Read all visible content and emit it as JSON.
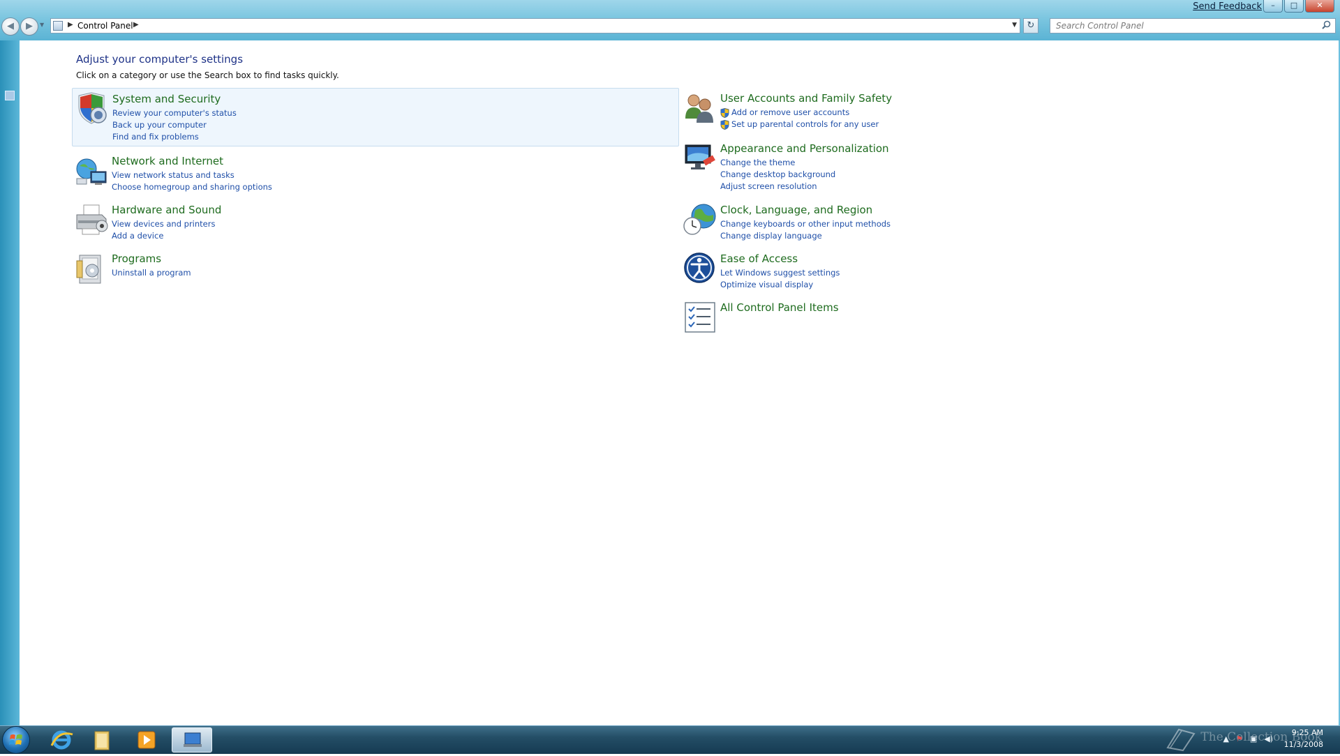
{
  "window": {
    "send_feedback": "Send Feedback",
    "minimize": "–",
    "maximize": "□",
    "close": "✕"
  },
  "nav": {
    "back_glyph": "◀",
    "forward_glyph": "▶"
  },
  "address": {
    "crumb": "Control Panel",
    "separator": "▶",
    "dropdown": "▼",
    "refresh_glyph": "↻"
  },
  "search": {
    "placeholder": "Search Control Panel",
    "icon": "search-icon"
  },
  "page": {
    "heading": "Adjust your computer's settings",
    "subheading": "Click on a category or use the Search box to find tasks quickly."
  },
  "categories_left": [
    {
      "title": "System and Security",
      "icon": "shield-icon",
      "links": [
        "Review your computer's status",
        "Back up your computer",
        "Find and fix problems"
      ]
    },
    {
      "title": "Network and Internet",
      "icon": "network-globe-icon",
      "links": [
        "View network status and tasks",
        "Choose homegroup and sharing options"
      ]
    },
    {
      "title": "Hardware and Sound",
      "icon": "printer-icon",
      "links": [
        "View devices and printers",
        "Add a device"
      ]
    },
    {
      "title": "Programs",
      "icon": "programs-icon",
      "links": [
        "Uninstall a program"
      ]
    }
  ],
  "categories_right": [
    {
      "title": "User Accounts and Family Safety",
      "icon": "users-icon",
      "links": [
        "Add or remove user accounts",
        "Set up parental controls for any user"
      ]
    },
    {
      "title": "Appearance and Personalization",
      "icon": "monitor-icon",
      "links": [
        "Change the theme",
        "Change desktop background",
        "Adjust screen resolution"
      ]
    },
    {
      "title": "Clock, Language, and Region",
      "icon": "clock-globe-icon",
      "links": [
        "Change keyboards or other input methods",
        "Change display language"
      ]
    },
    {
      "title": "Ease of Access",
      "icon": "ease-of-access-icon",
      "links": [
        "Let Windows suggest settings",
        "Optimize visual display"
      ]
    },
    {
      "title": "All Control Panel Items",
      "icon": "checklist-icon",
      "links": []
    }
  ],
  "taskbar": {
    "time": "9:25 AM",
    "date": "11/3/2008",
    "watermark": "The Collection Book",
    "tray_icons": [
      "up-arrow-icon",
      "flag-icon",
      "network-icon",
      "volume-icon"
    ]
  },
  "colors": {
    "category_title": "#1e6b1e",
    "link": "#1f4fa8",
    "heading": "#1e3287",
    "selected_bg": "#eef6fd"
  }
}
